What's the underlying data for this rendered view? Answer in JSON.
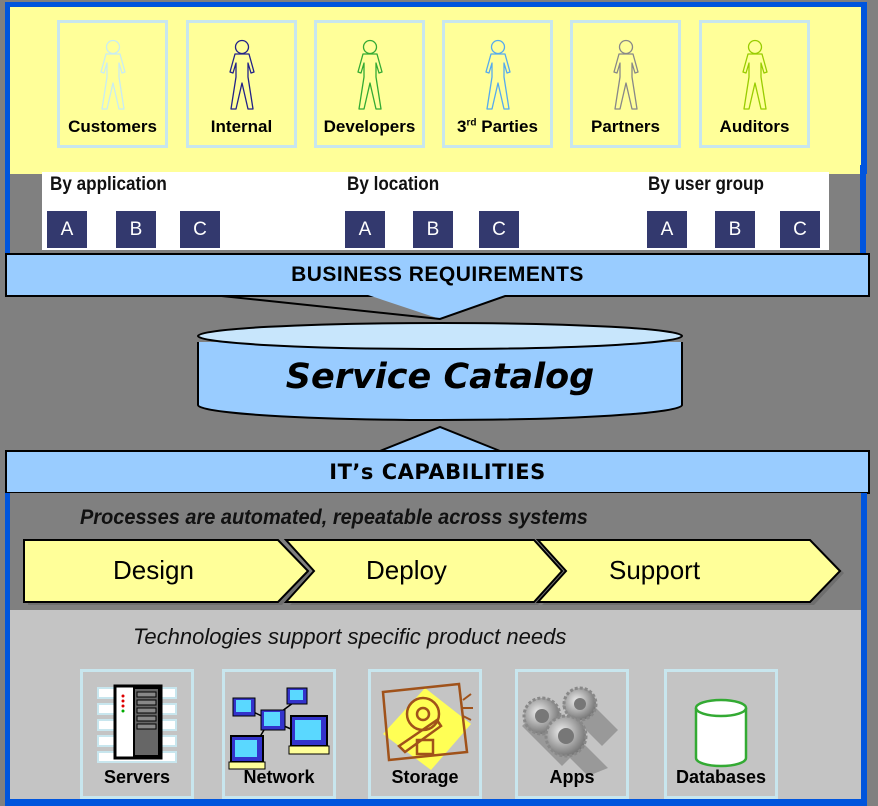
{
  "personas": [
    {
      "label": "Customers",
      "icon": "person-icon",
      "color": "#c8ecf4"
    },
    {
      "label": "Internal",
      "icon": "person-icon",
      "color": "#222288"
    },
    {
      "label": "Developers",
      "icon": "person-icon",
      "color": "#33aa33"
    },
    {
      "label_prefix": "3",
      "label_sup": "rd",
      "label_suffix": " Parties",
      "icon": "person-icon",
      "color": "#55aaee"
    },
    {
      "label": "Partners",
      "icon": "person-icon",
      "color": "#888888"
    },
    {
      "label": "Auditors",
      "icon": "person-icon",
      "color": "#99cc00"
    }
  ],
  "filters": [
    {
      "title": "By application",
      "chips": [
        "A",
        "B",
        "C"
      ]
    },
    {
      "title": "By location",
      "chips": [
        "A",
        "B",
        "C"
      ]
    },
    {
      "title": "By user group",
      "chips": [
        "A",
        "B",
        "C"
      ]
    }
  ],
  "business_requirements": "BUSINESS REQUIREMENTS",
  "service_catalog": "Service Catalog",
  "it_capabilities": "IT’s CAPABILITIES",
  "processes_caption": "Processes are automated, repeatable across systems",
  "process_steps": [
    "Design",
    "Deploy",
    "Support"
  ],
  "technologies_caption": "Technologies support specific product needs",
  "technologies": [
    {
      "label": "Servers",
      "icon": "server-icon"
    },
    {
      "label": "Network",
      "icon": "network-icon"
    },
    {
      "label": "Storage",
      "icon": "hard-drive-icon"
    },
    {
      "label": "Apps",
      "icon": "gears-icon"
    },
    {
      "label": "Databases",
      "icon": "database-icon"
    }
  ],
  "colors": {
    "frame_blue": "#0055dd",
    "top_yellow": "#ffff99",
    "banner_blue": "#99ccff",
    "chip_navy": "#33396e",
    "step_yellow": "#ffff99",
    "tile_border": "#c8e6ee"
  }
}
